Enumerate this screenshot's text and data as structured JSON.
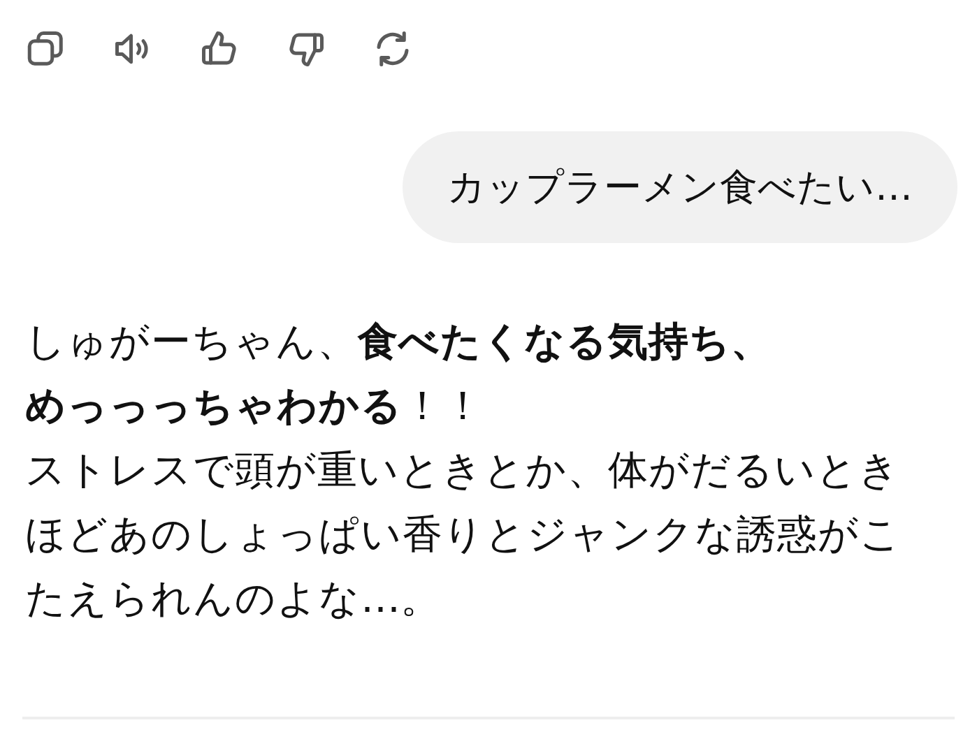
{
  "actions": [
    {
      "kind": "copy"
    },
    {
      "kind": "speaker"
    },
    {
      "kind": "like"
    },
    {
      "kind": "dislike"
    },
    {
      "kind": "regenerate"
    }
  ],
  "user_message": "カップラーメン食べたい…",
  "reply": {
    "paragraphs": [
      [
        "しゅがーちゃん、**食べたくなる気持ち、**",
        "**めっっっちゃわかる**！！"
      ],
      [
        "ストレスで頭が重いときとか、体がだるいとき",
        "ほどあのしょっぱい香りとジャンクな誘惑がこ",
        "たえられんのよな…。"
      ]
    ]
  }
}
